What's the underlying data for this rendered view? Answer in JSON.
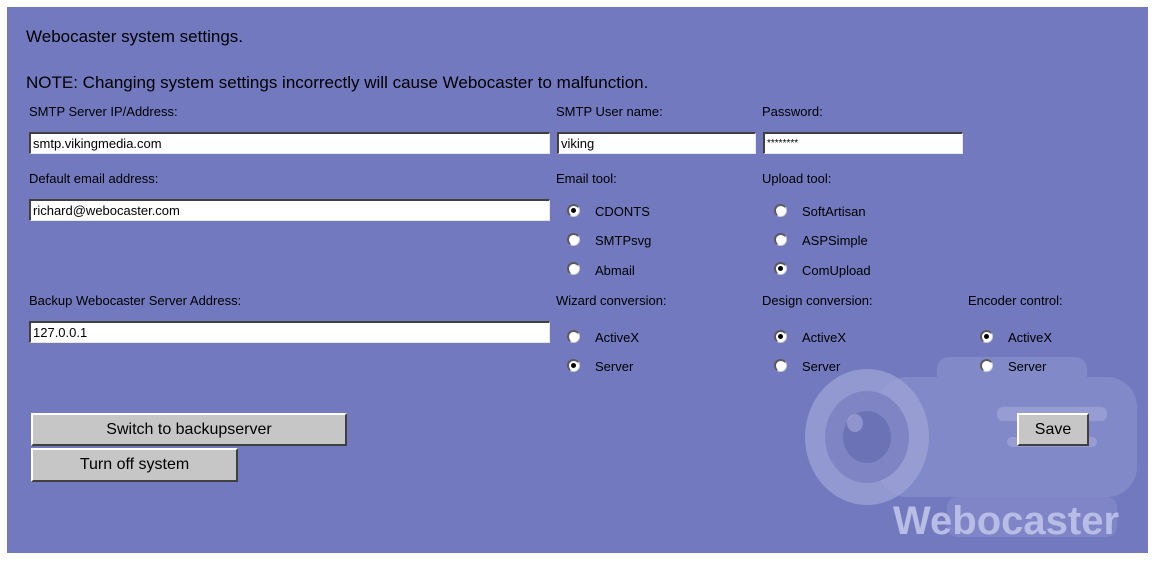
{
  "page": {
    "title": "Webocaster system settings.",
    "note": "NOTE: Changing system settings incorrectly will cause Webocaster to malfunction."
  },
  "smtp": {
    "server_label": "SMTP Server IP/Address:",
    "server_value": "smtp.vikingmedia.com",
    "user_label": "SMTP User name:",
    "user_value": "viking",
    "password_label": "Password:",
    "password_value": "********"
  },
  "email": {
    "default_label": "Default email address:",
    "default_value": "richard@webocaster.com",
    "tool_label": "Email tool:",
    "tool_options": [
      "CDONTS",
      "SMTPsvg",
      "Abmail"
    ],
    "tool_selected": "CDONTS"
  },
  "upload": {
    "tool_label": "Upload tool:",
    "tool_options": [
      "SoftArtisan",
      "ASPSimple",
      "ComUpload"
    ],
    "tool_selected": "ComUpload"
  },
  "backup": {
    "label": "Backup Webocaster Server Address:",
    "value": "127.0.0.1"
  },
  "wizard": {
    "label": "Wizard conversion:",
    "options": [
      "ActiveX",
      "Server"
    ],
    "selected": "Server"
  },
  "design": {
    "label": "Design conversion:",
    "options": [
      "ActiveX",
      "Server"
    ],
    "selected": "ActiveX"
  },
  "encoder": {
    "label": "Encoder control:",
    "options": [
      "ActiveX",
      "Server"
    ],
    "selected": "ActiveX"
  },
  "buttons": {
    "switch": "Switch to backupserver",
    "turn_off": "Turn off system",
    "save": "Save"
  },
  "branding": {
    "logo_text": "Webocaster",
    "watermark_icon": "video-camera-icon"
  }
}
